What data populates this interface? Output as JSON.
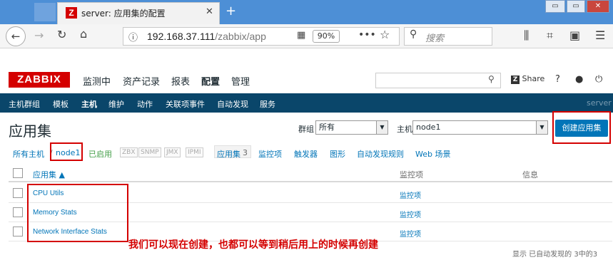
{
  "browser": {
    "tab_title": "server: 应用集的配置",
    "tab_icon_letter": "Z",
    "url_host": "192.168.37.111",
    "url_path": "/zabbix/app",
    "zoom": "90%",
    "search_placeholder": "搜索",
    "window_buttons": [
      "▭",
      "▭",
      "✕"
    ]
  },
  "zabbix": {
    "logo": "ZABBIX",
    "main_menu": [
      "监测中",
      "资产记录",
      "报表",
      "配置",
      "管理"
    ],
    "share_label": "Share",
    "sub_menu": [
      "主机群组",
      "模板",
      "主机",
      "维护",
      "动作",
      "关联项事件",
      "自动发现",
      "服务"
    ],
    "server_label": "server"
  },
  "page": {
    "title": "应用集",
    "group_label": "群组",
    "group_value": "所有",
    "host_label": "主机",
    "host_value": "node1",
    "create_button": "创建应用集"
  },
  "filter_row": {
    "all_hosts": "所有主机",
    "separator": "/",
    "host": "node1",
    "enabled": "已启用",
    "tags": [
      "ZBX",
      "SNMP",
      "JMX",
      "IPMI"
    ],
    "applications": "应用集",
    "applications_count": "3",
    "items": "监控项",
    "triggers": "触发器",
    "graphs": "图形",
    "discovery": "自动发现规则",
    "web": "Web 场景"
  },
  "table": {
    "headers": {
      "name": "应用集 ▲",
      "items": "监控项",
      "info": "信息"
    },
    "rows": [
      {
        "name": "CPU Utils",
        "items": "监控项"
      },
      {
        "name": "Memory Stats",
        "items": "监控项"
      },
      {
        "name": "Network Interface Stats",
        "items": "监控项"
      }
    ],
    "footer": "显示 已自动发现的 3中的3"
  },
  "annotation": "我们可以现在创建，也都可以等到稍后用上的时候再创建",
  "colors": {
    "titlebar": "#4d8fd6",
    "zabbix_red": "#d40000",
    "subnav": "#0a466a",
    "link": "#0275b8",
    "enabled": "#429e47",
    "annotation": "#d40000"
  }
}
